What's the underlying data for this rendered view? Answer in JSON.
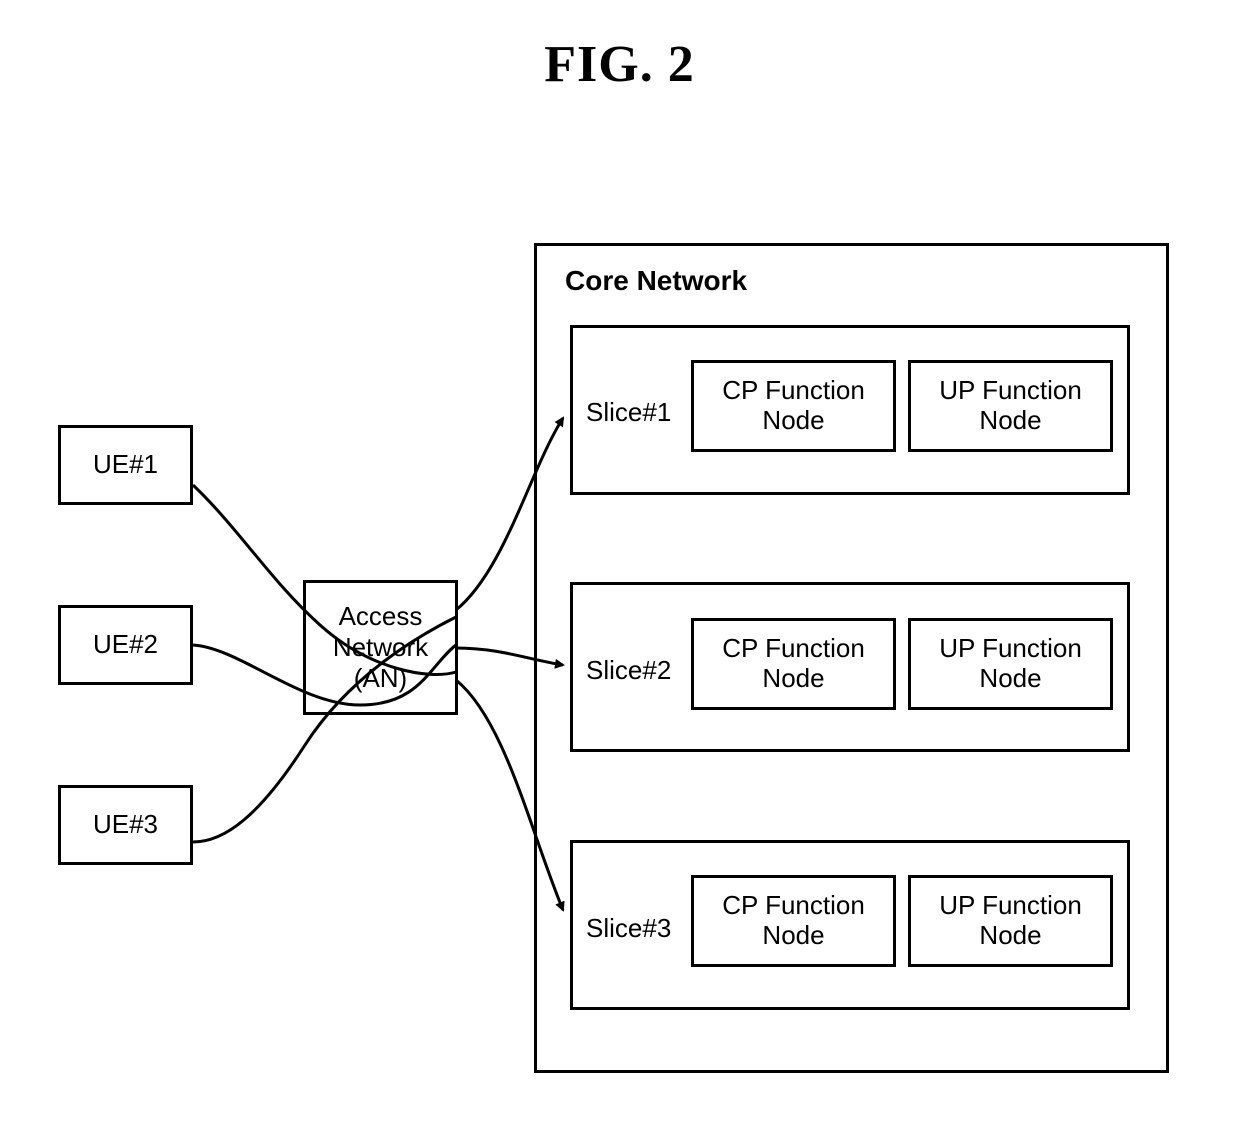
{
  "figure_title": "FIG. 2",
  "ue_labels": [
    "UE#1",
    "UE#2",
    "UE#3"
  ],
  "an_label": "Access Network (AN)",
  "core_title": "Core Network",
  "slices": [
    {
      "label": "Slice#1",
      "cp": "CP Function Node",
      "up": "UP Function Node"
    },
    {
      "label": "Slice#2",
      "cp": "CP Function Node",
      "up": "UP Function Node"
    },
    {
      "label": "Slice#3",
      "cp": "CP Function Node",
      "up": "UP Function Node"
    }
  ]
}
